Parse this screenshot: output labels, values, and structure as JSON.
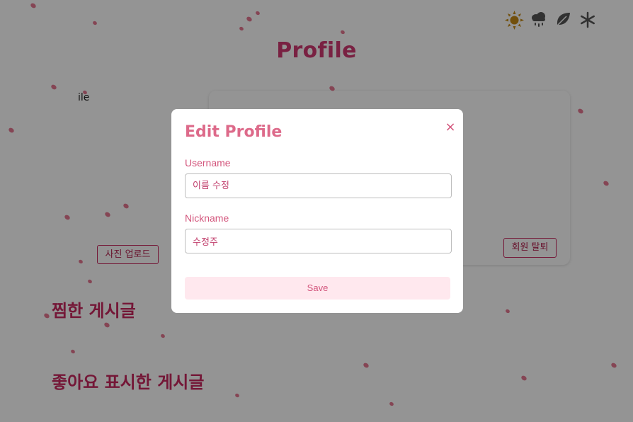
{
  "header": {
    "season_icons": [
      {
        "name": "sun-icon",
        "color": "#c48a17"
      },
      {
        "name": "rain-cloud-icon",
        "color": "#555555"
      },
      {
        "name": "leaf-icon",
        "color": "#555555"
      },
      {
        "name": "snowflake-icon",
        "color": "#555555"
      }
    ]
  },
  "main": {
    "title": "Profile",
    "profile_image_label_fragment": "ile",
    "upload_button_label": "사진 업로드",
    "withdraw_button_label": "회원 탈퇴",
    "sections": {
      "bookmarked_title": "찜한 게시글",
      "liked_title": "좋아요 표시한 게시글"
    }
  },
  "modal": {
    "title": "Edit Profile",
    "close_glyph": "×",
    "username_label": "Username",
    "username_placeholder": "이름 수정",
    "nickname_label": "Nickname",
    "nickname_value": "수정주",
    "save_label": "Save"
  },
  "colors": {
    "accent": "#c8285f",
    "modal_accent": "#d3557c",
    "petal": "#e0607e",
    "overlay": "rgba(0,0,0,0.42)"
  }
}
